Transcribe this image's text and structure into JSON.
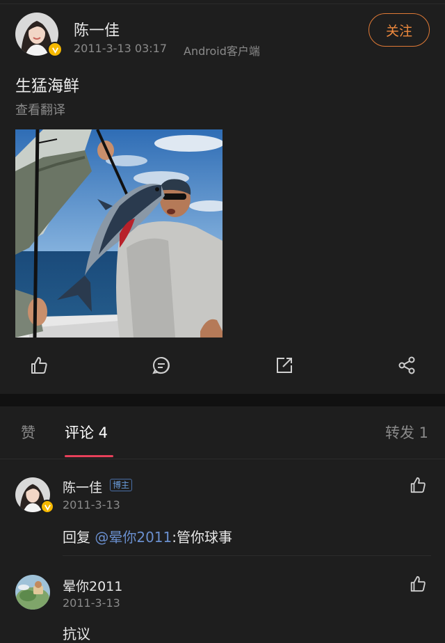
{
  "post": {
    "author": "陈一佳",
    "time": "2011-3-13 03:17",
    "source": "Android客户端",
    "follow_label": "关注",
    "text": "生猛海鲜",
    "translate_label": "查看翻译",
    "actions": [
      "like-icon",
      "comment-icon",
      "repost-icon",
      "share-icon"
    ]
  },
  "tabs": {
    "likes_label": "赞",
    "comments_label": "评论 4",
    "reposts_label": "转发 1",
    "active": "comments"
  },
  "comments": [
    {
      "author": "陈一佳",
      "tag": "博主",
      "date": "2011-3-13",
      "reply_prefix": "回复 ",
      "mention": "@晕你2011",
      "text": ":管你球事"
    },
    {
      "author": "晕你2011",
      "date": "2011-3-13",
      "text": "抗议"
    }
  ],
  "colors": {
    "background": "#1e1e1e",
    "accent_follow": "#f08a3e",
    "tab_underline": "#e8405a",
    "mention": "#6a8fce",
    "verified_badge": "#f5b800"
  }
}
